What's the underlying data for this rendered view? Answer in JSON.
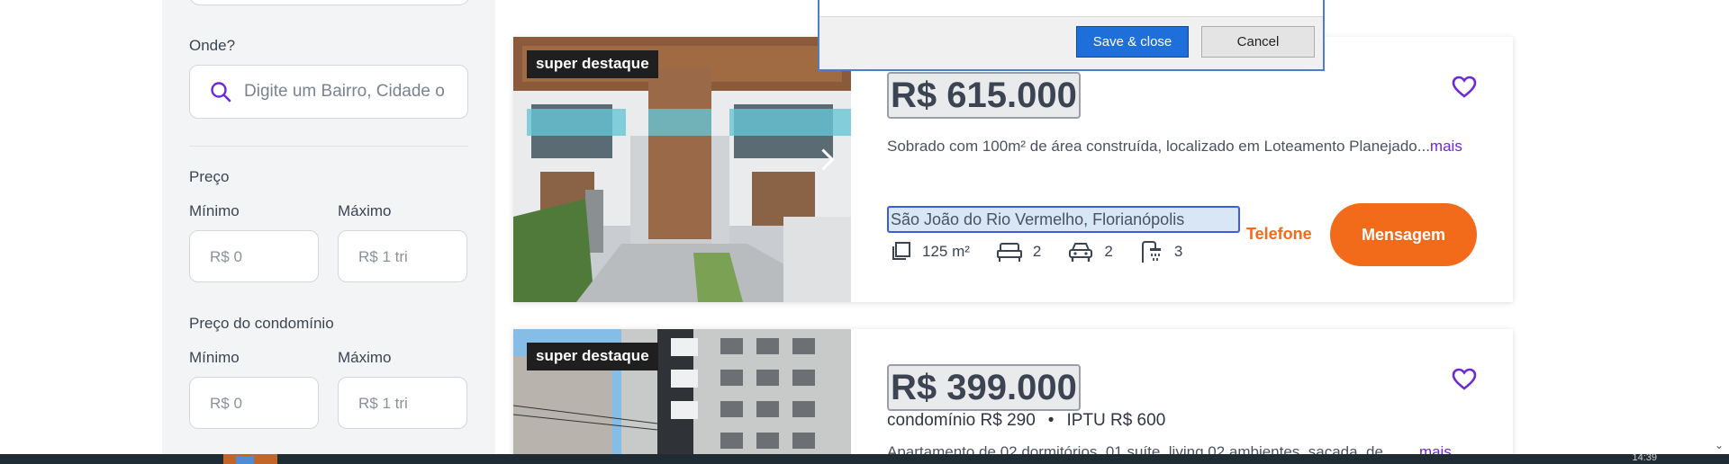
{
  "sidebar": {
    "where_label": "Onde?",
    "search_placeholder": "Digite um Bairro, Cidade o",
    "price_label": "Preço",
    "min_label": "Mínimo",
    "max_label": "Máximo",
    "min_placeholder": "R$ 0",
    "max_placeholder": "R$ 1 tri",
    "condo_label": "Preço do condomínio",
    "condo_min_label": "Mínimo",
    "condo_max_label": "Máximo",
    "condo_min_placeholder": "R$ 0",
    "condo_max_placeholder": "R$ 1 tri"
  },
  "dialog": {
    "save_label": "Save & close",
    "cancel_label": "Cancel"
  },
  "listings": [
    {
      "badge": "super destaque",
      "price": "R$ 615.000",
      "description": "Sobrado com 100m² de área construída, localizado em Loteamento Planejado...",
      "more": "mais",
      "address": "São João do Rio Vermelho, Florianópolis",
      "area": "125 m²",
      "bedrooms": "2",
      "parking": "2",
      "bathrooms": "3",
      "phone_label": "Telefone",
      "message_label": "Mensagem"
    },
    {
      "badge": "super destaque",
      "price": "R$ 399.000",
      "condo_fee": "condomínio R$ 290",
      "separator": "•",
      "iptu": "IPTU R$ 600",
      "description": "Apartamento de 02 dormitórios, 01 suíte, living 02 ambientes, sacada, de",
      "more": "mais"
    }
  ],
  "taskbar": {
    "clock": "14:39"
  },
  "colors": {
    "accent_purple": "#6d28d9",
    "accent_orange": "#f26b1b",
    "dialog_blue": "#1e6fd9"
  }
}
